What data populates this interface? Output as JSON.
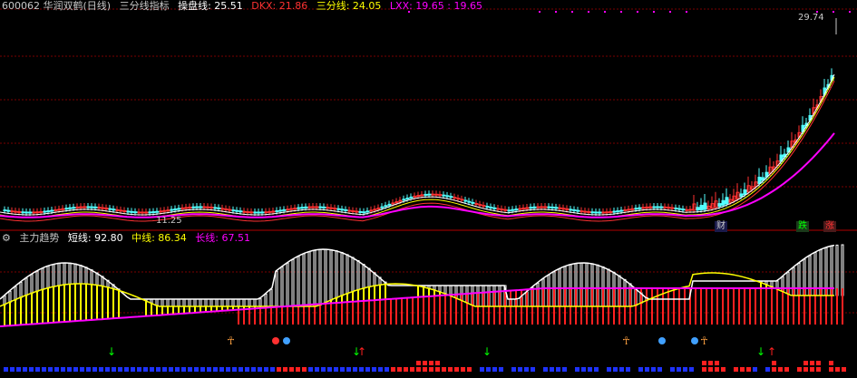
{
  "top_header": {
    "symbol": "600062 华润双鹤(日线)",
    "indicator": "三分线指标",
    "cpx_label": "操盘线: 25.51",
    "dkx_label": "DKX: 21.86",
    "sfx_label": "三分线: 24.05",
    "lxx_label": "LXX: 19.65 : 19.65"
  },
  "bottom_header": {
    "indicator": "主力趋势",
    "short_label": "短线: 92.80",
    "mid_label": "中线: 86.34",
    "long_label": "长线: 67.51"
  },
  "price_labels": {
    "high": "29.74",
    "low": "11.25"
  },
  "event_badges": [
    "财",
    "跌",
    "涨"
  ],
  "colors": {
    "background": "#000000",
    "grid": "#7a0000",
    "up": "#ff3232",
    "down": "#54ffff",
    "short_line": "#ffffff",
    "mid_line": "#ffff00",
    "long_line": "#ff00ff",
    "magenta_dots": "#ff00ff",
    "bar_red": "#ff2020",
    "bar_blue": "#1e32ff",
    "arrow_green": "#00ff00",
    "arrow_red": "#ff2020"
  },
  "icons": [
    "down-arrow-icon",
    "up-arrow-icon",
    "runner-icon",
    "red-ball-icon",
    "blue-ball-icon"
  ]
}
